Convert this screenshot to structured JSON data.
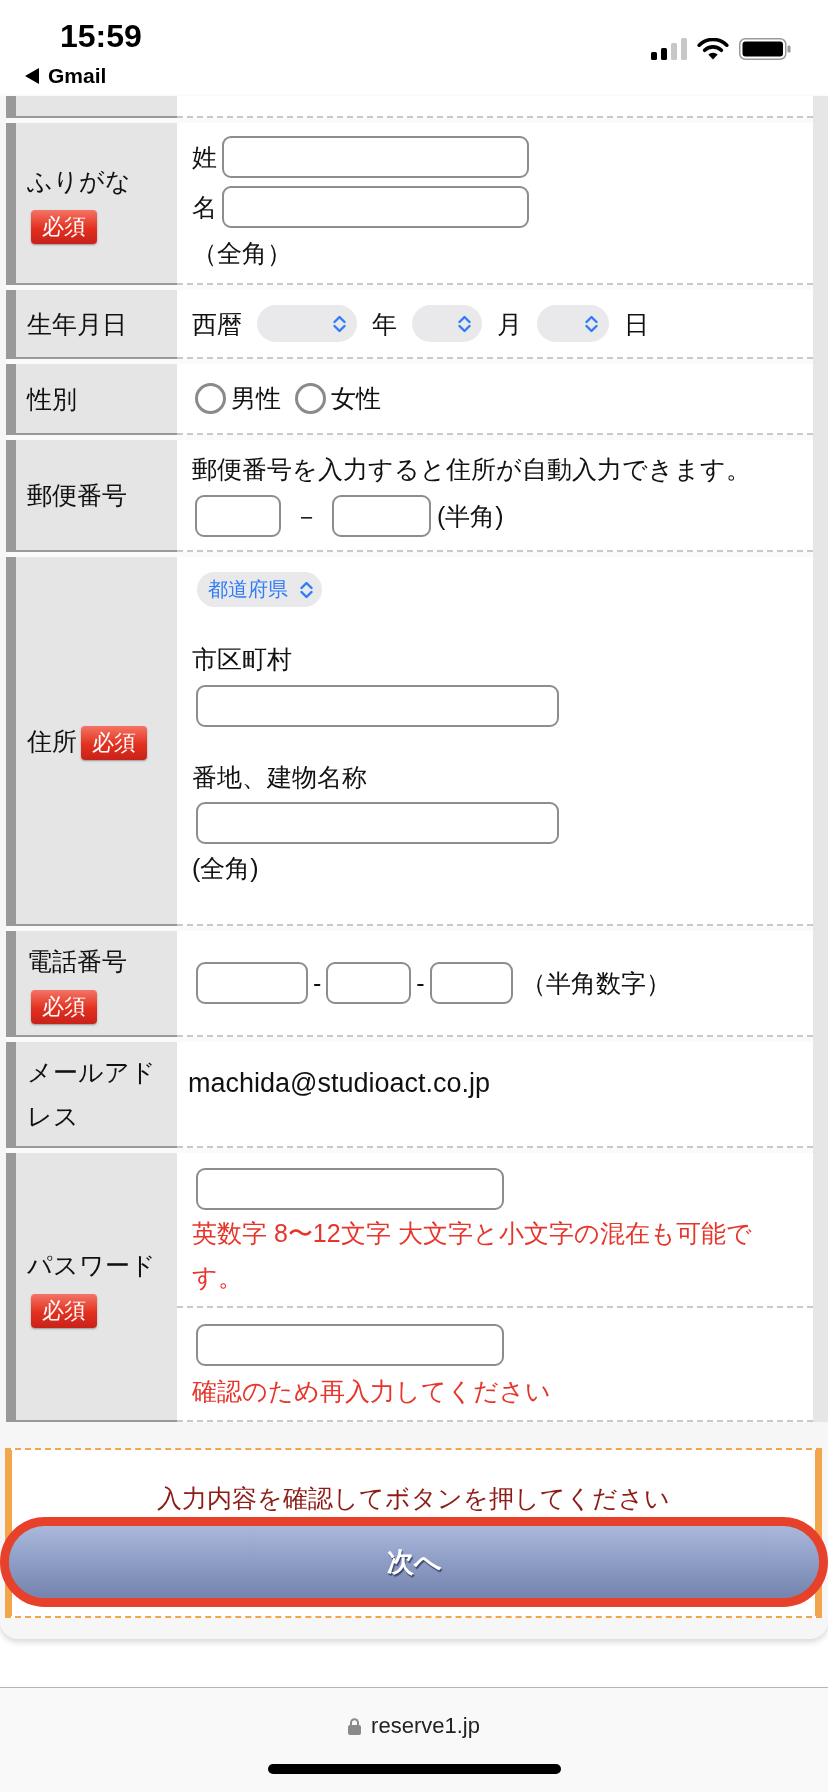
{
  "status_bar": {
    "time": "15:59",
    "back_label": "Gmail"
  },
  "form": {
    "rows": [
      {
        "kind": "partial"
      },
      {
        "kind": "name_kana",
        "label": "ふりがな",
        "badge": "必須",
        "fields": [
          {
            "prefix": "姓"
          },
          {
            "prefix": "名"
          }
        ],
        "note": "（全角）"
      },
      {
        "kind": "date",
        "label": "生年月日",
        "prefix": "西暦",
        "selects": [
          {
            "unit": "年"
          },
          {
            "unit": "月"
          },
          {
            "unit": "日"
          }
        ]
      },
      {
        "kind": "radio",
        "label": "性別",
        "options": [
          {
            "label": "男性",
            "selected": false
          },
          {
            "label": "女性",
            "selected": false
          }
        ]
      },
      {
        "kind": "zip",
        "label": "郵便番号",
        "hint": "郵便番号を入力すると住所が自動入力できます。",
        "separators": [
          "－"
        ],
        "note": "(半角)"
      },
      {
        "kind": "address",
        "label": "住所",
        "badge": "必須",
        "prefecture": "都道府県",
        "city_label": "市区町村",
        "street_label": "番地、建物名称",
        "note": "(全角)"
      },
      {
        "kind": "phone",
        "label": "電話番号",
        "badge": "必須",
        "separators": [
          "-",
          "-"
        ],
        "note": "（半角数字）"
      },
      {
        "kind": "static",
        "label": "メールアドレス",
        "value": "machida@studioact.co.jp"
      },
      {
        "kind": "password",
        "label": "パスワード",
        "badge": "必須",
        "entries": [
          {
            "hint": "英数字 8〜12文字 大文字と小文字の混在も可能です。"
          },
          {
            "hint": "確認のため再入力してください"
          }
        ]
      }
    ]
  },
  "confirm": {
    "message": "入力内容を確認してボタンを押してください",
    "button": {
      "label": "次へ",
      "highlighted": true
    }
  },
  "browser_bar": {
    "url": "reserve1.jp"
  }
}
